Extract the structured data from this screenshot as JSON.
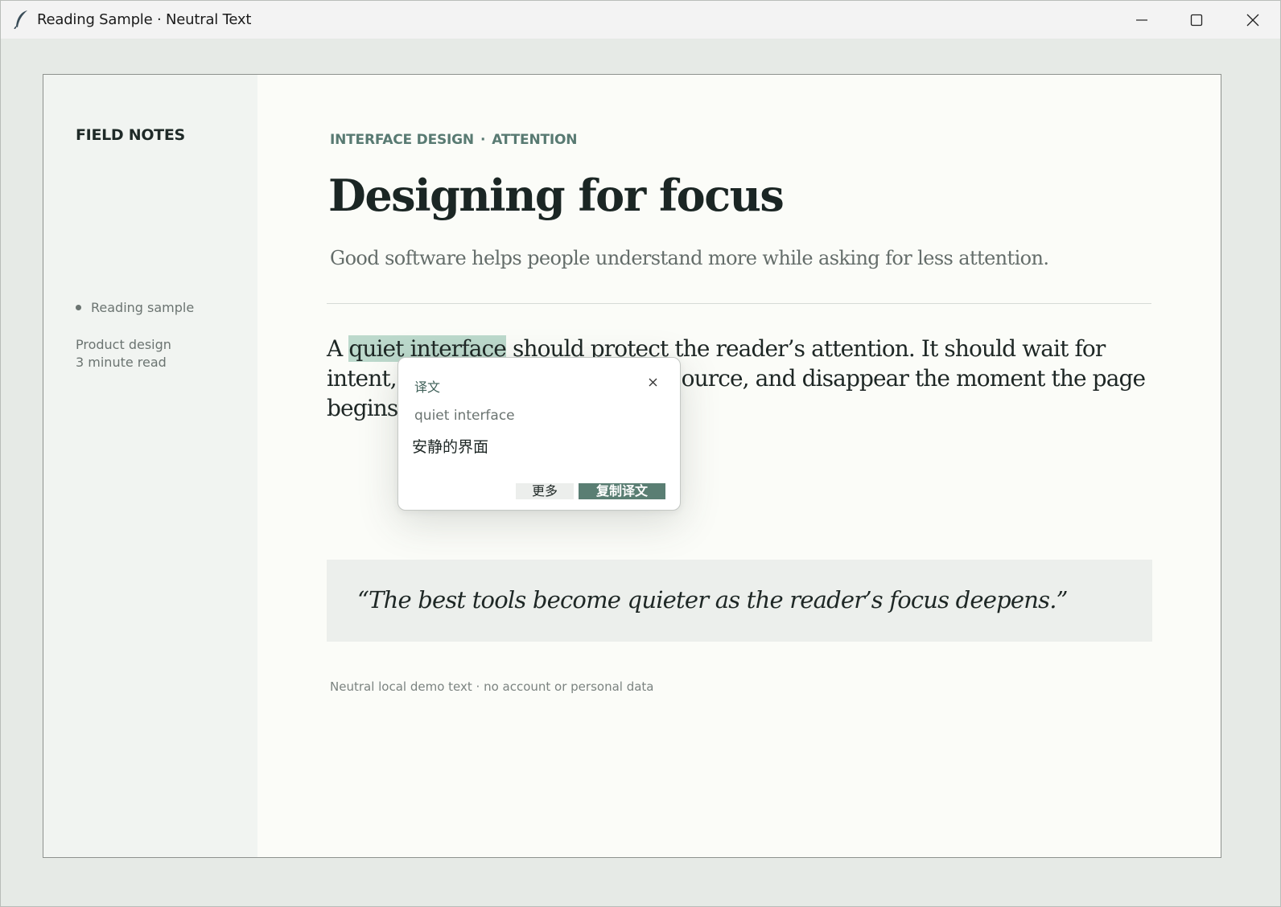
{
  "window": {
    "title": "Reading Sample · Neutral Text",
    "icons": {
      "app": "feather-icon",
      "minimize": "minimize-icon",
      "maximize": "maximize-icon",
      "close": "close-icon"
    }
  },
  "sidebar": {
    "brand": "FIELD NOTES",
    "nav_active": "Reading sample",
    "meta": [
      "Product design",
      "3 minute read"
    ]
  },
  "article": {
    "kicker": [
      "INTERFACE DESIGN",
      "·",
      "ATTENTION"
    ],
    "headline": "Designing for focus",
    "dek": "Good software helps people understand more while asking for less attention.",
    "body": {
      "before": "A ",
      "highlight": "quiet interface",
      "after": " should protect the reader’s attention. It should wait for intent, keep results close to the source, and disappear the moment the page begins to change."
    },
    "quote": "“The best tools become quieter as the reader’s focus deepens.”",
    "footer": "Neutral local demo text · no account or personal data"
  },
  "popup": {
    "title": "译文",
    "close_label": "×",
    "source": "quiet interface",
    "translation": "安静的界面",
    "more_label": "更多",
    "copy_label": "复制译文"
  },
  "colors": {
    "accent": "#5a7e73",
    "highlight": "#bcd9cc",
    "kicker": "#587a72",
    "page_bg": "#fbfcf8",
    "sidebar_bg": "#f1f4f1"
  }
}
